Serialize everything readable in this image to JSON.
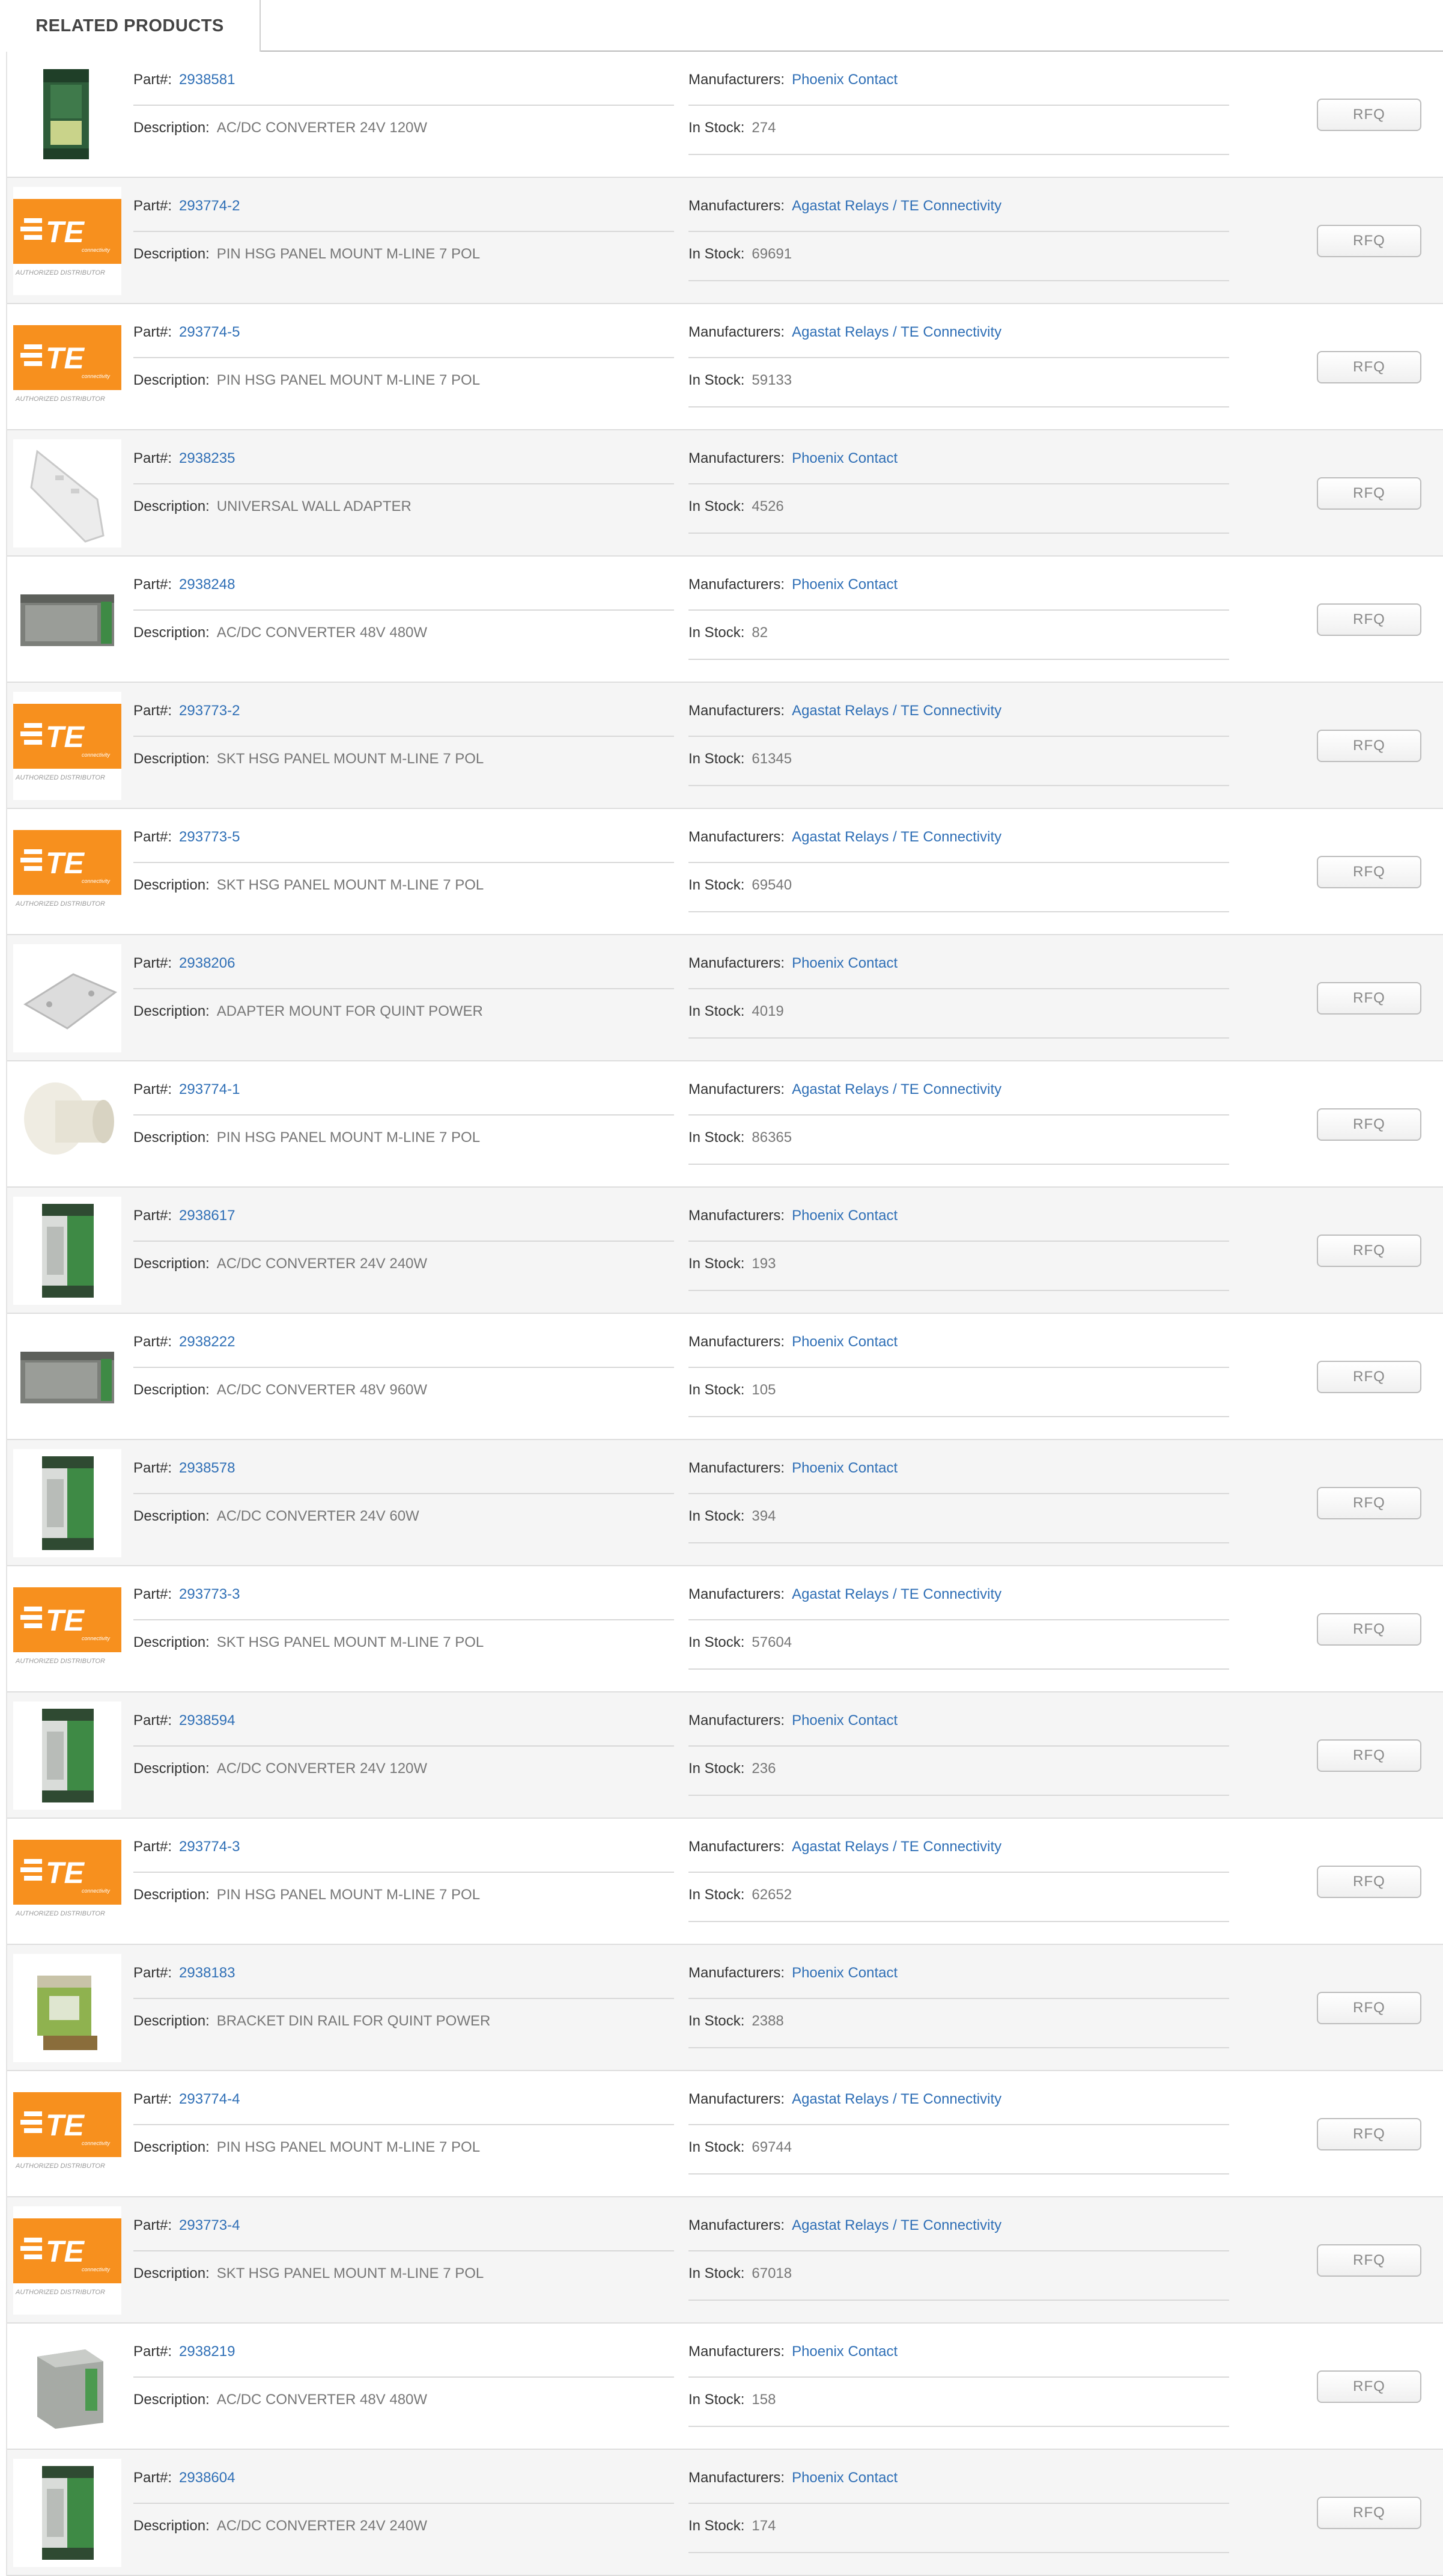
{
  "tab": {
    "label": "RELATED PRODUCTS"
  },
  "labels": {
    "part": "Part#:",
    "description": "Description:",
    "manufacturers": "Manufacturers:",
    "in_stock": "In Stock:",
    "rfq": "RFQ"
  },
  "logo": {
    "brand": "TE",
    "sub": "connectivity",
    "caption": "AUTHORIZED DISTRIBUTOR",
    "color": "#f7901e"
  },
  "products": [
    {
      "part": "2938581",
      "description": "AC/DC CONVERTER 24V 120W",
      "manufacturer": "Phoenix Contact",
      "stock": "274",
      "image": "power-supply-green-icon"
    },
    {
      "part": "293774-2",
      "description": "PIN HSG PANEL MOUNT M-LINE 7 POL",
      "manufacturer": "Agastat Relays / TE Connectivity",
      "stock": "69691",
      "image": "te-logo"
    },
    {
      "part": "293774-5",
      "description": "PIN HSG PANEL MOUNT M-LINE 7 POL",
      "manufacturer": "Agastat Relays / TE Connectivity",
      "stock": "59133",
      "image": "te-logo"
    },
    {
      "part": "2938235",
      "description": "UNIVERSAL WALL ADAPTER",
      "manufacturer": "Phoenix Contact",
      "stock": "4526",
      "image": "wall-adapter-icon"
    },
    {
      "part": "2938248",
      "description": "AC/DC CONVERTER 48V 480W",
      "manufacturer": "Phoenix Contact",
      "stock": "82",
      "image": "power-supply-wide-icon"
    },
    {
      "part": "293773-2",
      "description": "SKT HSG PANEL MOUNT M-LINE 7 POL",
      "manufacturer": "Agastat Relays / TE Connectivity",
      "stock": "61345",
      "image": "te-logo"
    },
    {
      "part": "293773-5",
      "description": "SKT HSG PANEL MOUNT M-LINE 7 POL",
      "manufacturer": "Agastat Relays / TE Connectivity",
      "stock": "69540",
      "image": "te-logo"
    },
    {
      "part": "2938206",
      "description": "ADAPTER MOUNT FOR QUINT POWER",
      "manufacturer": "Phoenix Contact",
      "stock": "4019",
      "image": "mount-plate-icon"
    },
    {
      "part": "293774-1",
      "description": "PIN HSG PANEL MOUNT M-LINE 7 POL",
      "manufacturer": "Agastat Relays / TE Connectivity",
      "stock": "86365",
      "image": "connector-housing-icon"
    },
    {
      "part": "2938617",
      "description": "AC/DC CONVERTER 24V 240W",
      "manufacturer": "Phoenix Contact",
      "stock": "193",
      "image": "power-supply-silver-icon"
    },
    {
      "part": "2938222",
      "description": "AC/DC CONVERTER 48V 960W",
      "manufacturer": "Phoenix Contact",
      "stock": "105",
      "image": "power-supply-wide-icon"
    },
    {
      "part": "2938578",
      "description": "AC/DC CONVERTER 24V 60W",
      "manufacturer": "Phoenix Contact",
      "stock": "394",
      "image": "power-supply-silver-icon"
    },
    {
      "part": "293773-3",
      "description": "SKT HSG PANEL MOUNT M-LINE 7 POL",
      "manufacturer": "Agastat Relays / TE Connectivity",
      "stock": "57604",
      "image": "te-logo"
    },
    {
      "part": "2938594",
      "description": "AC/DC CONVERTER 24V 120W",
      "manufacturer": "Phoenix Contact",
      "stock": "236",
      "image": "power-supply-silver-icon"
    },
    {
      "part": "293774-3",
      "description": "PIN HSG PANEL MOUNT M-LINE 7 POL",
      "manufacturer": "Agastat Relays / TE Connectivity",
      "stock": "62652",
      "image": "te-logo"
    },
    {
      "part": "2938183",
      "description": "BRACKET DIN RAIL FOR QUINT POWER",
      "manufacturer": "Phoenix Contact",
      "stock": "2388",
      "image": "din-bracket-icon"
    },
    {
      "part": "293774-4",
      "description": "PIN HSG PANEL MOUNT M-LINE 7 POL",
      "manufacturer": "Agastat Relays / TE Connectivity",
      "stock": "69744",
      "image": "te-logo"
    },
    {
      "part": "293773-4",
      "description": "SKT HSG PANEL MOUNT M-LINE 7 POL",
      "manufacturer": "Agastat Relays / TE Connectivity",
      "stock": "67018",
      "image": "te-logo"
    },
    {
      "part": "2938219",
      "description": "AC/DC CONVERTER 48V 480W",
      "manufacturer": "Phoenix Contact",
      "stock": "158",
      "image": "power-supply-box-icon"
    },
    {
      "part": "2938604",
      "description": "AC/DC CONVERTER 24V 240W",
      "manufacturer": "Phoenix Contact",
      "stock": "174",
      "image": "power-supply-silver-icon"
    }
  ]
}
